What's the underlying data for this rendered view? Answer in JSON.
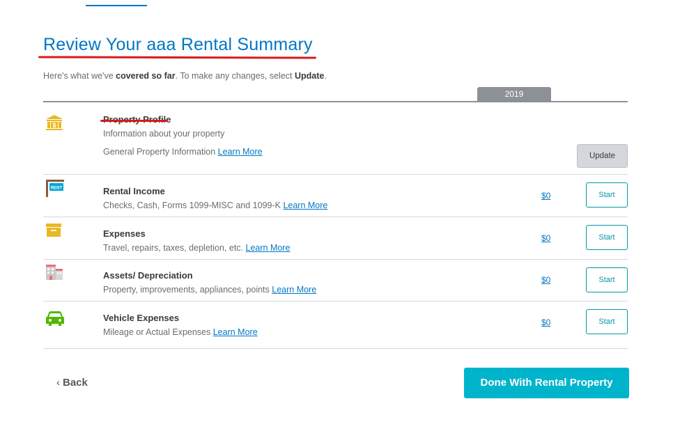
{
  "header": {
    "title": "Review Your aaa Rental Summary",
    "intro_1": "Here's what we've ",
    "intro_bold_1": "covered so far",
    "intro_2": ". To make any changes, select ",
    "intro_bold_2": "Update",
    "intro_3": "."
  },
  "table": {
    "year": "2019",
    "learn_more": "Learn More",
    "start_label": "Start",
    "update_label": "Update",
    "profile": {
      "name": "Property Profile",
      "subtitle": "Information about your property",
      "detail": "General Property Information ",
      "icon": "bank-dollar-icon"
    },
    "rows": [
      {
        "name": "Rental Income",
        "desc": "Checks, Cash, Forms 1099-MISC and 1099-K ",
        "amount": "$0",
        "icon": "rent-sign-icon"
      },
      {
        "name": "Expenses",
        "desc": "Travel, repairs, taxes, depletion, etc. ",
        "amount": "$0",
        "icon": "box-icon"
      },
      {
        "name": "Assets/ Depreciation",
        "desc": "Property, improvements, appliances, points ",
        "amount": "$0",
        "icon": "buildings-icon"
      },
      {
        "name": "Vehicle Expenses",
        "desc": "Mileage or Actual Expenses ",
        "amount": "$0",
        "icon": "car-icon"
      }
    ]
  },
  "footer": {
    "back_label": "Back",
    "done_label": "Done With Rental Property"
  },
  "colors": {
    "brand_blue": "#0077c5",
    "teal": "#00b4cc",
    "annotation_red": "#d81b1b",
    "icon_gold": "#e8b923",
    "icon_green": "#53b700"
  }
}
